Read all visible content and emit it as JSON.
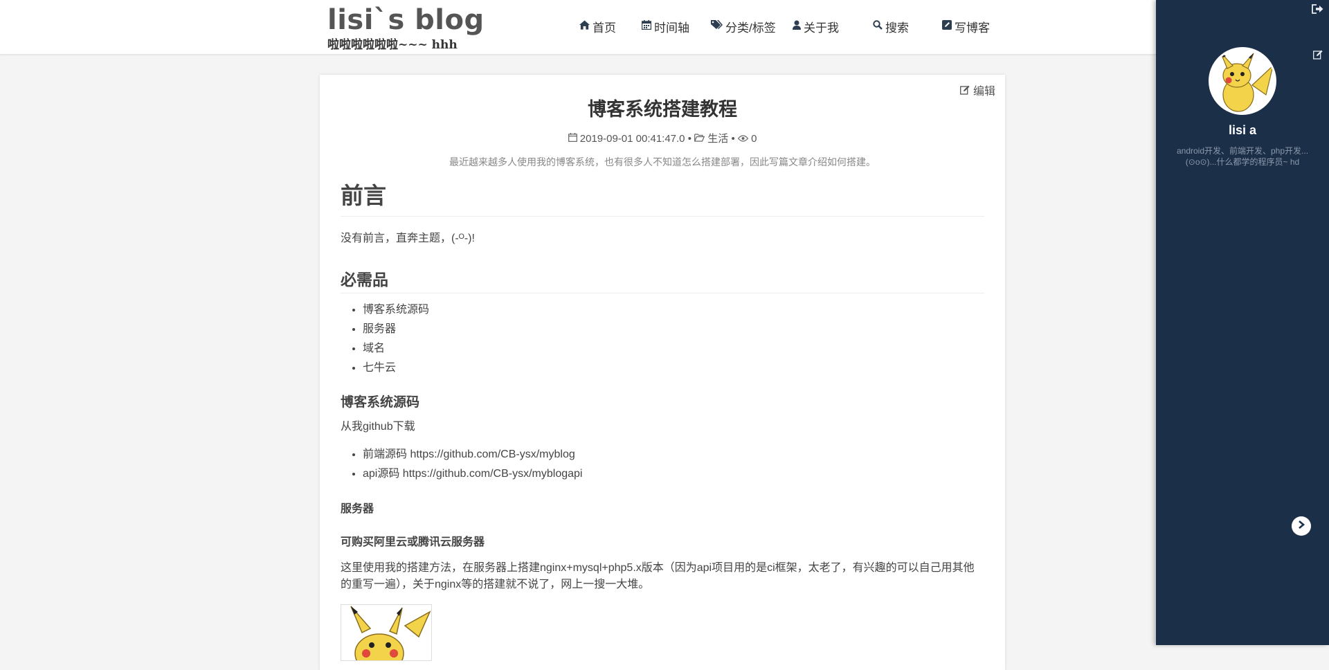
{
  "header": {
    "brand_title": "lisi`s blog",
    "brand_sub": "啦啦啦啦啦啦~~~ hhh",
    "nav": [
      {
        "label": "首页",
        "icon": "home-icon"
      },
      {
        "label": "时间轴",
        "icon": "calendar-icon"
      },
      {
        "label": "分类/标签",
        "icon": "tags-icon"
      },
      {
        "label": "关于我",
        "icon": "user-icon"
      },
      {
        "label": "搜索",
        "icon": "search-icon"
      },
      {
        "label": "写博客",
        "icon": "edit-icon"
      }
    ]
  },
  "article": {
    "edit_label": "编辑",
    "title": "博客系统搭建教程",
    "date": "2019-09-01 00:41:47.0",
    "category": "生活",
    "views": "0",
    "summary": "最近越来越多人使用我的博客系统，也有很多人不知道怎么搭建部署，因此写篇文章介绍如何搭建。",
    "h_preface": "前言",
    "p_preface": "没有前言，直奔主题，(-ᴼ-)!",
    "h_required": "必需品",
    "required_items": [
      "博客系统源码",
      "服务器",
      "域名",
      "七牛云"
    ],
    "h_source": "博客系统源码",
    "p_source": "从我github下载",
    "source_items": [
      "前端源码 https://github.com/CB-ysx/myblog",
      "api源码 https://github.com/CB-ysx/myblogapi"
    ],
    "h_server": "服务器",
    "h_server_buy": "可购买阿里云或腾讯云服务器",
    "p_server_1": "这里使用我的搭建方法，在服务器上搭建nginx+mysql+php5.x版本（因为api项目用的是ci框架，太老了，有兴趣的可以自己用其他",
    "p_server_2": "的重写一遍），关于nginx等的搭建就不说了，网上一搜一大堆。"
  },
  "sidebar": {
    "name": "lisi a",
    "bio_1": "android开发、前端开发、php开发...",
    "bio_2": "(⊙o⊙)...什么都学的程序员~ hd"
  },
  "colors": {
    "sidebar_bg": "#1c2f48",
    "text": "#333333",
    "accent_yellow": "#f3d34a"
  }
}
